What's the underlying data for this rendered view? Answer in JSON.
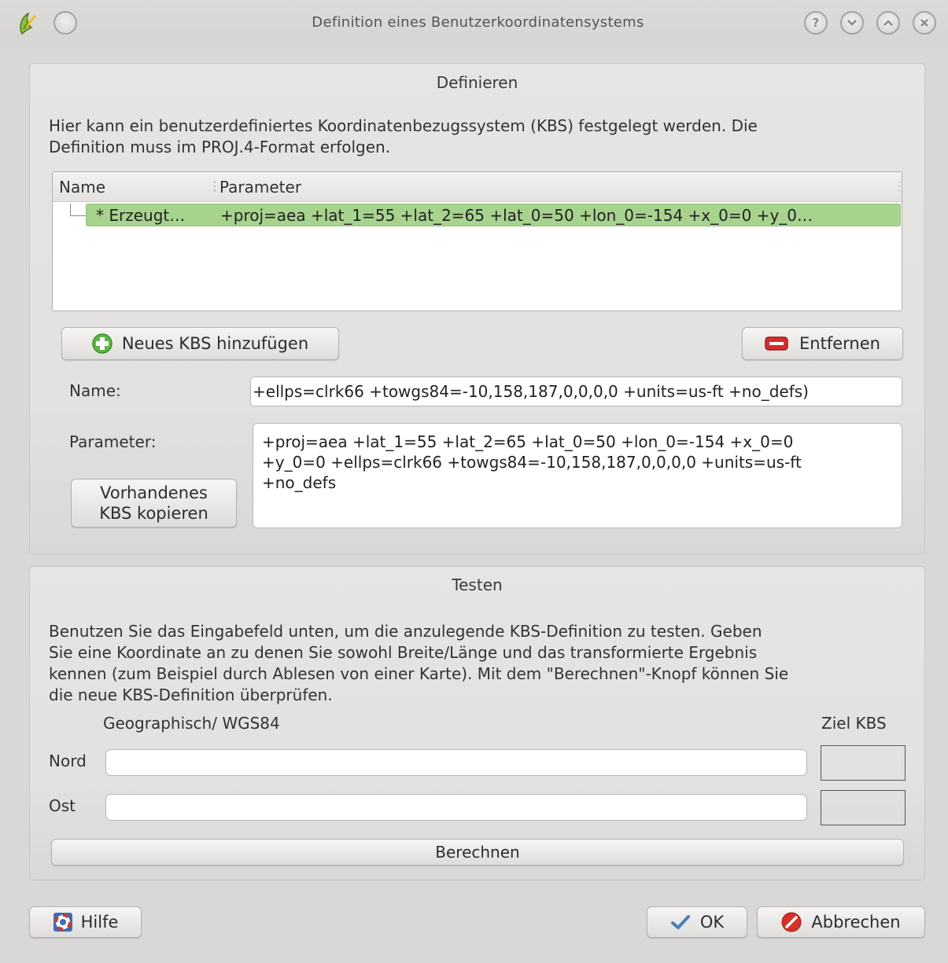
{
  "window": {
    "title": "Definition eines Benutzerkoordinatensystems"
  },
  "define": {
    "title": "Definieren",
    "description_line1": "Hier kann ein benutzerdefiniertes Koordinatenbezugssystem (KBS) festgelegt werden. Die",
    "description_line2": "Definition muss im PROJ.4-Format erfolgen.",
    "table": {
      "headers": [
        "Name",
        "Parameter"
      ],
      "rows": [
        {
          "name": "* Erzeugt…",
          "parameter": "+proj=aea +lat_1=55 +lat_2=65 +lat_0=50 +lon_0=-154 +x_0=0 +y_0…"
        }
      ]
    },
    "add_button": "Neues KBS hinzufügen",
    "remove_button": "Entfernen",
    "name_label": "Name:",
    "name_value": "+ellps=clrk66 +towgs84=-10,158,187,0,0,0,0 +units=us-ft +no_defs)",
    "parameter_label": "Parameter:",
    "parameter_lines": [
      "+proj=aea +lat_1=55 +lat_2=65 +lat_0=50 +lon_0=-154 +x_0=0",
      "+y_0=0 +ellps=clrk66 +towgs84=-10,158,187,0,0,0,0 +units=us-ft",
      "+no_defs"
    ],
    "copy_button_line1": "Vorhandenes",
    "copy_button_line2": "KBS kopieren"
  },
  "test": {
    "title": "Testen",
    "description_lines": [
      "Benutzen Sie das Eingabefeld unten, um die anzulegende KBS-Definition zu testen. Geben",
      "Sie eine Koordinate an zu denen Sie sowohl Breite/Länge und das transformierte Ergebnis",
      "kennen (zum Beispiel durch Ablesen von einer Karte). Mit dem \"Berechnen\"-Knopf können Sie",
      "die neue KBS-Definition überprüfen."
    ],
    "geo_header": "Geographisch/ WGS84",
    "target_header": "Ziel KBS",
    "north_label": "Nord",
    "east_label": "Ost",
    "north_value": "",
    "east_value": "",
    "north_result": "",
    "east_result": "",
    "calculate_button": "Berechnen"
  },
  "footer": {
    "help_button": "Hilfe",
    "ok_button": "OK",
    "cancel_button": "Abbrechen"
  },
  "icons": {
    "app": "qgis-logo-icon",
    "add": "green-plus-icon",
    "remove": "red-minus-icon",
    "help": "lifebuoy-icon",
    "ok": "checkmark-icon",
    "cancel": "cancel-icon"
  },
  "colors": {
    "selected_row": "#a7d38f",
    "window_bg": "#d9d8d6"
  }
}
